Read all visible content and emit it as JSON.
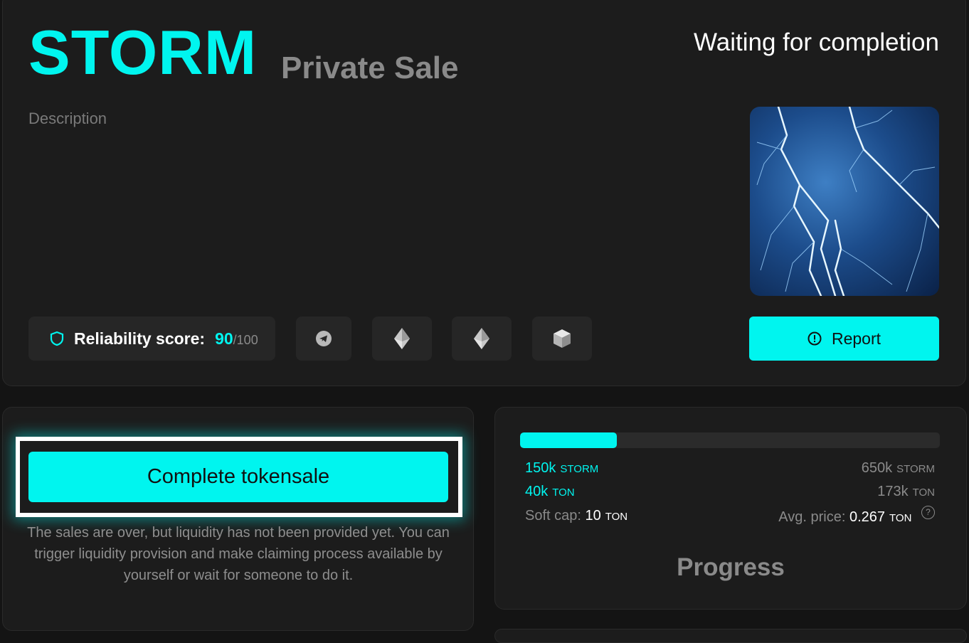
{
  "header": {
    "token_name": "STORM",
    "sale_type": "Private Sale",
    "status": "Waiting for completion",
    "description_label": "Description"
  },
  "image": {
    "name": "storm-lightning-image"
  },
  "reliability": {
    "label": "Reliability score:",
    "score": "90",
    "max": "/100"
  },
  "socials": [
    {
      "name": "telegram-icon"
    },
    {
      "name": "ethereum-icon"
    },
    {
      "name": "ethereum-icon"
    },
    {
      "name": "cube-icon"
    }
  ],
  "report_button": {
    "label": "Report"
  },
  "complete": {
    "button_label": "Complete tokensale",
    "note": "The sales are over, but liquidity has not been provided yet. You can trigger liquidity provision and make claiming process available by yourself or wait for someone to do it."
  },
  "progress": {
    "fraction": 0.23,
    "raised_tokens": "150k",
    "raised_tokens_unit": "STORM",
    "total_tokens": "650k",
    "total_tokens_unit": "STORM",
    "raised_ton": "40k",
    "raised_ton_unit": "TON",
    "total_ton": "173k",
    "total_ton_unit": "TON",
    "soft_cap_label": "Soft cap:",
    "soft_cap_value": "10",
    "soft_cap_unit": "TON",
    "avg_price_label": "Avg. price:",
    "avg_price_value": "0.267",
    "avg_price_unit": "TON",
    "help_glyph": "?",
    "title": "Progress"
  },
  "colors": {
    "accent": "#00f5ef",
    "card": "#1c1c1c",
    "background": "#141414"
  }
}
